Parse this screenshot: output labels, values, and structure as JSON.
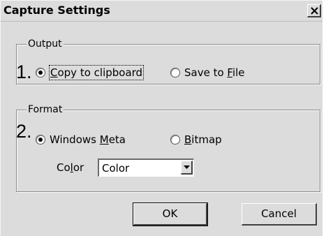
{
  "window": {
    "title": "Capture Settings"
  },
  "output_group": {
    "legend": "Output",
    "step_number": "1.",
    "options": [
      {
        "label_parts": [
          "",
          "C",
          "opy to clipboard"
        ],
        "selected": true
      },
      {
        "label_parts": [
          "Save to ",
          "F",
          "ile"
        ],
        "selected": false
      }
    ]
  },
  "format_group": {
    "legend": "Format",
    "step_number": "2.",
    "options": [
      {
        "label_parts": [
          "Windows ",
          "M",
          "eta"
        ],
        "selected": true
      },
      {
        "label_parts": [
          "",
          "B",
          "itmap"
        ],
        "selected": false
      }
    ],
    "color_label_parts": [
      "Co",
      "l",
      "or"
    ],
    "color_select": {
      "value": "Color"
    }
  },
  "buttons": {
    "ok": "OK",
    "cancel": "Cancel"
  },
  "icons": {
    "close": "close-icon",
    "dropdown": "chevron-down-icon",
    "radio_selected": "radio-selected-icon",
    "radio_unselected": "radio-unselected-icon"
  }
}
